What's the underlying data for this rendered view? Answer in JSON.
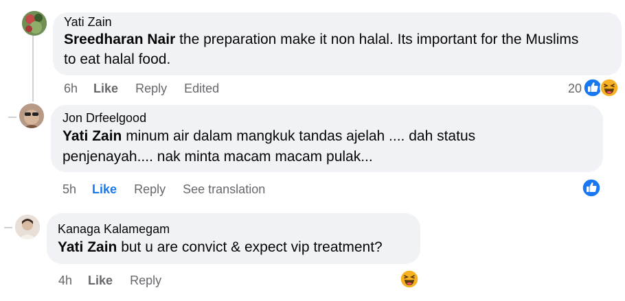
{
  "comments": [
    {
      "author": "Yati Zain",
      "tag": "Sreedharan Nair",
      "line1": " the preparation make it non halal. Its important for the Muslims",
      "line2": "to eat halal food.",
      "time": "6h",
      "like": "Like",
      "reply": "Reply",
      "extra": "Edited",
      "reaction_count": "20",
      "reactions": [
        "like-icon",
        "haha-icon"
      ]
    },
    {
      "author": "Jon Drfeelgood",
      "tag": "Yati Zain",
      "line1": " minum air dalam mangkuk tandas ajelah .... dah status",
      "line2": "penjenayah.... nak minta macam macam pulak...",
      "time": "5h",
      "like": "Like",
      "reply": "Reply",
      "extra": "See translation",
      "reactions": [
        "like-icon"
      ]
    },
    {
      "author": "Kanaga Kalamegam",
      "tag": "Yati Zain",
      "line1": " but u are convict & expect vip treatment?",
      "time": "4h",
      "like": "Like",
      "reply": "Reply",
      "reactions": [
        "haha-icon"
      ]
    }
  ],
  "colors": {
    "bubble": "#f0f2f5",
    "meta": "#65676b",
    "accent": "#1877f2",
    "thread_line": "#ced0d4"
  }
}
